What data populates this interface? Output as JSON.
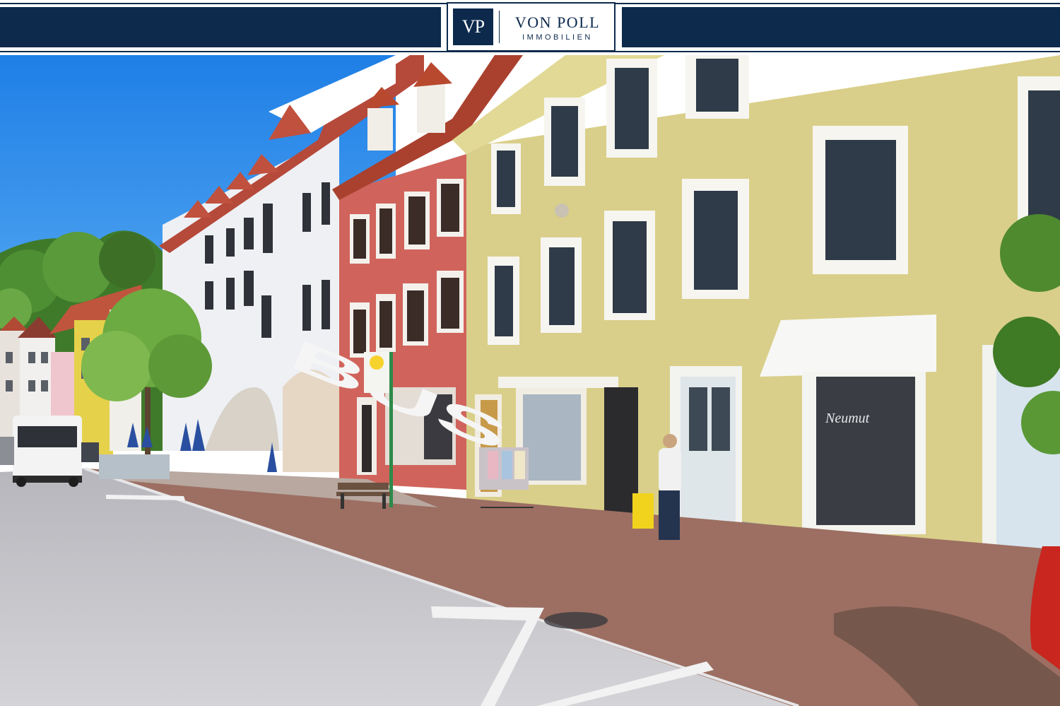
{
  "banner": {
    "logo_mark": "VP",
    "brand_name": "VON POLL",
    "brand_sub": "IMMOBILIEN",
    "brand_color": "#0d2a4c"
  },
  "photo": {
    "road_marking": "BUS",
    "shop_sign": "Neumut",
    "colors": {
      "sky": "#1f7fe6",
      "yellow_building": "#d9cf8a",
      "red_building": "#d0645c",
      "white_building": "#eef0f4",
      "pavement": "#9c6f62",
      "road": "#c9c9cf"
    }
  }
}
